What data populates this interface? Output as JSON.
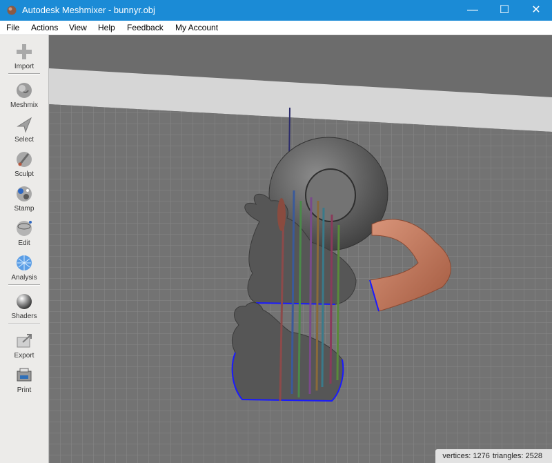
{
  "window": {
    "title": "Autodesk Meshmixer - bunnyr.obj",
    "controls": {
      "minimize": "—",
      "maximize": "☐",
      "close": "✕"
    },
    "accent_color": "#1b8bd6"
  },
  "menu": [
    {
      "label": "File"
    },
    {
      "label": "Actions"
    },
    {
      "label": "View"
    },
    {
      "label": "Help"
    },
    {
      "label": "Feedback"
    },
    {
      "label": "My Account"
    }
  ],
  "toolbar": [
    {
      "label": "Import",
      "icon": "plus-icon"
    },
    {
      "label": "Meshmix",
      "icon": "meshmix-icon"
    },
    {
      "label": "Select",
      "icon": "cursor-arrow-icon"
    },
    {
      "label": "Sculpt",
      "icon": "brush-icon"
    },
    {
      "label": "Stamp",
      "icon": "stamp-icon"
    },
    {
      "label": "Edit",
      "icon": "edit-sphere-icon"
    },
    {
      "label": "Analysis",
      "icon": "analysis-sphere-icon"
    },
    {
      "label": "Shaders",
      "icon": "shader-ball-icon"
    },
    {
      "label": "Export",
      "icon": "export-icon"
    },
    {
      "label": "Print",
      "icon": "printer-icon"
    }
  ],
  "status": {
    "vertices": "vertices: 1276",
    "triangles": "triangles: 2528"
  },
  "scene": {
    "objects": [
      "bunny",
      "bunny",
      "torus",
      "arm"
    ],
    "boundary_color": "#1a1aff"
  }
}
